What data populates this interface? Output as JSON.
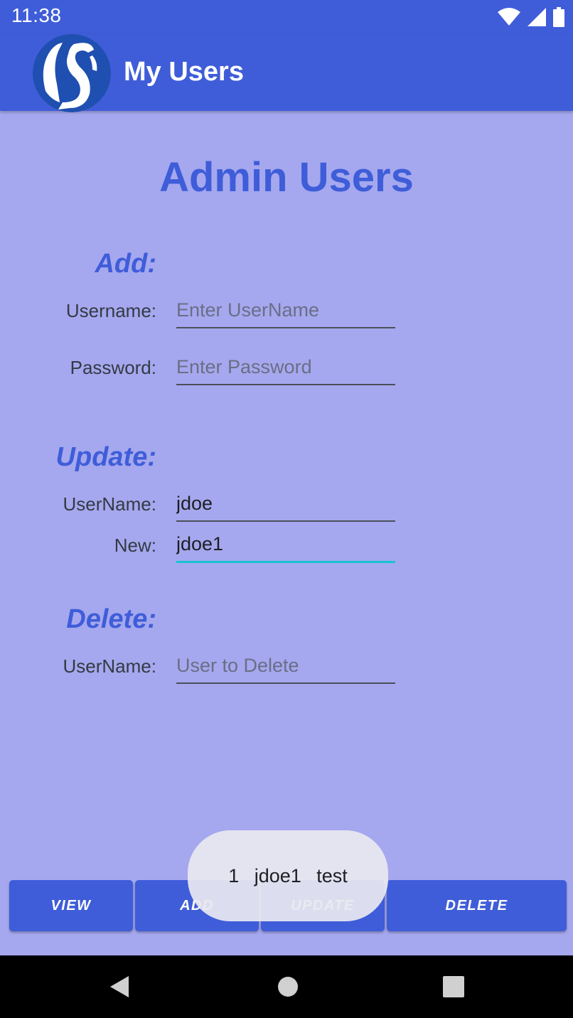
{
  "status_bar": {
    "time": "11:38"
  },
  "app_bar": {
    "title": "My Users"
  },
  "page": {
    "title": "Admin Users"
  },
  "add_section": {
    "heading": "Add:",
    "username_label": "Username:",
    "username_placeholder": "Enter UserName",
    "username_value": "",
    "password_label": "Password:",
    "password_placeholder": "Enter Password",
    "password_value": ""
  },
  "update_section": {
    "heading": "Update:",
    "username_label": "UserName:",
    "username_value": "jdoe",
    "new_label": "New:",
    "new_value": "jdoe1"
  },
  "delete_section": {
    "heading": "Delete:",
    "username_label": "UserName:",
    "username_placeholder": "User to Delete",
    "username_value": ""
  },
  "buttons": {
    "view": "VIEW",
    "add": "ADD",
    "update": "UPDATE",
    "delete": "DELETE"
  },
  "toast": {
    "message": "1 jdoe1 test"
  },
  "colors": {
    "primary": "#3f5dd9",
    "background": "#a5a8ee",
    "accent": "#17c4cf"
  },
  "icons": {
    "wifi": "wifi-icon",
    "signal": "signal-icon",
    "battery": "battery-icon",
    "back": "back-icon",
    "home": "home-icon",
    "recents": "recents-icon"
  }
}
